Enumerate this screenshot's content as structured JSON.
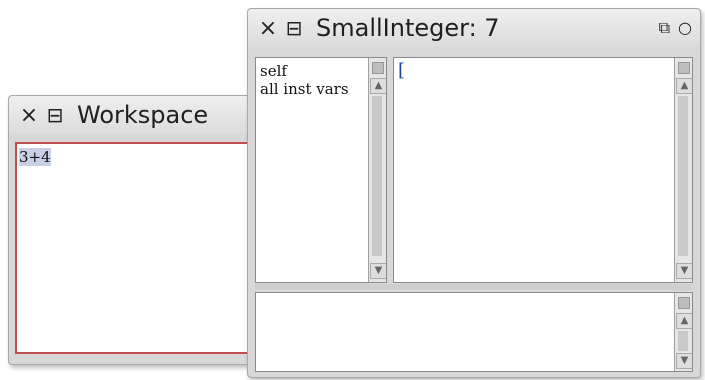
{
  "workspace": {
    "title": "Workspace",
    "close_glyph": "×",
    "menu_glyph": "⊟",
    "code": "3+4",
    "border_color": "#c05050"
  },
  "inspector": {
    "title": "SmallInteger: 7",
    "close_glyph": "×",
    "menu_glyph": "⊟",
    "collapse_glyph": "⧉",
    "expand_glyph": "○",
    "fields": [
      "self",
      "all inst vars"
    ],
    "value_text": "[",
    "eval_text": ""
  },
  "icons": {
    "close": "close-icon",
    "menu": "window-menu-icon",
    "collapse": "collapse-icon",
    "expand": "expand-icon",
    "up": "scroll-up-icon",
    "down": "scroll-down-icon"
  }
}
